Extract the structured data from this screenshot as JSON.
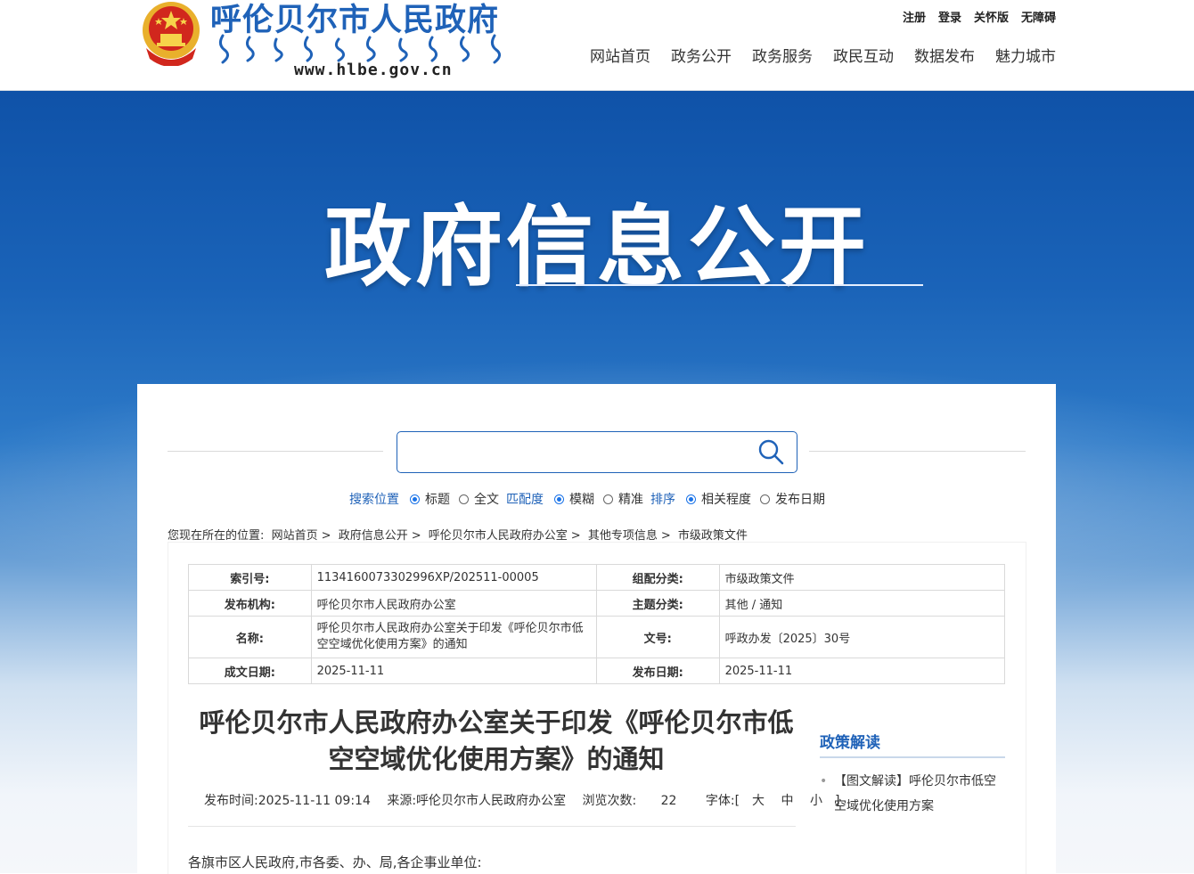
{
  "header": {
    "site_title": "呼伦贝尔市人民政府",
    "domain": "www.hlbe.gov.cn",
    "top_links": [
      "注册",
      "登录",
      "关怀版",
      "无障碍"
    ],
    "nav": [
      "网站首页",
      "政务公开",
      "政务服务",
      "政民互动",
      "数据发布",
      "魅力城市"
    ]
  },
  "banner": {
    "title": "政府信息公开"
  },
  "search": {
    "placeholder": "",
    "position_label": "搜索位置",
    "position_options": [
      "标题",
      "全文"
    ],
    "match_label": "匹配度",
    "match_options": [
      "模糊",
      "精准"
    ],
    "sort_label": "排序",
    "sort_options": [
      "相关程度",
      "发布日期"
    ]
  },
  "breadcrumb": {
    "prefix": "您现在所在的位置:",
    "items": [
      "网站首页",
      "政府信息公开",
      "呼伦贝尔市人民政府办公室",
      "其他专项信息",
      "市级政策文件"
    ]
  },
  "meta": {
    "index_label": "索引号:",
    "index_value": "1134160073302996XP/202511-00005",
    "category_label": "组配分类:",
    "category_value": "市级政策文件",
    "publisher_label": "发布机构:",
    "publisher_value": "呼伦贝尔市人民政府办公室",
    "topic_label": "主题分类:",
    "topic_value": "其他 / 通知",
    "name_label": "名称:",
    "name_value": "呼伦贝尔市人民政府办公室关于印发《呼伦贝尔市低空空域优化使用方案》的通知",
    "docno_label": "文号:",
    "docno_value": "呼政办发〔2025〕30号",
    "created_label": "成文日期:",
    "created_value": "2025-11-11",
    "published_label": "发布日期:",
    "published_value": "2025-11-11"
  },
  "article": {
    "title": "呼伦贝尔市人民政府办公室关于印发《呼伦贝尔市低空空域优化使用方案》的通知",
    "publish_time": "发布时间:2025-11-11 09:14",
    "source": "来源:呼伦贝尔市人民政府办公室",
    "views_label": "浏览次数:",
    "views": "22",
    "font_label": "字体:[",
    "font_large": "大",
    "font_medium": "中",
    "font_small": "小",
    "font_end": "]",
    "salutation": "各旗市区人民政府,市各委、办、局,各企事业单位:"
  },
  "sidebar": {
    "title": "政策解读",
    "items": [
      "【图文解读】呼伦贝尔市低空空域优化使用方案"
    ]
  },
  "colors": {
    "brand_blue": "#1f62b8",
    "radio_blue": "#1a73e8"
  }
}
